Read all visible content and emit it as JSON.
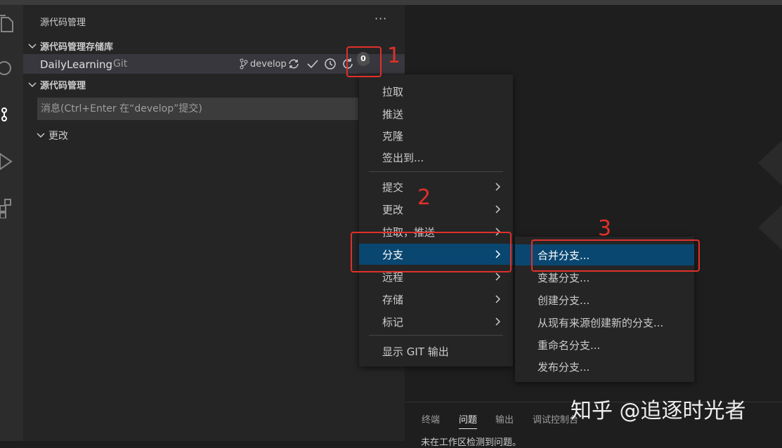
{
  "sidebar": {
    "title": "源代码管理",
    "more_icon": "ellipsis-icon",
    "repositories_header": "源代码管理存储库",
    "repo": {
      "name": "DailyLearning",
      "type": "Git",
      "branch": "develop",
      "badge_count": "0"
    },
    "scm_header": "源代码管理",
    "commit_placeholder": "消息(Ctrl+Enter 在“develop”提交)",
    "changes_label": "更改"
  },
  "context_menu": {
    "items": [
      {
        "label": "拉取"
      },
      {
        "label": "推送"
      },
      {
        "label": "克隆"
      },
      {
        "label": "签出到..."
      },
      {
        "label": "提交"
      },
      {
        "label": "更改"
      },
      {
        "label": "拉取，推送"
      },
      {
        "label": "分支"
      },
      {
        "label": "远程"
      },
      {
        "label": "存储"
      },
      {
        "label": "标记"
      },
      {
        "label": "显示 GIT 输出"
      }
    ]
  },
  "branch_submenu": {
    "items": [
      {
        "label": "合并分支..."
      },
      {
        "label": "变基分支..."
      },
      {
        "label": "创建分支..."
      },
      {
        "label": "从现有来源创建新的分支..."
      },
      {
        "label": "重命名分支..."
      },
      {
        "label": "发布分支..."
      }
    ]
  },
  "panel": {
    "tabs": [
      "终端",
      "问题",
      "输出",
      "调试控制台"
    ],
    "active_tab": "问题",
    "message": "未在工作区检测到问题。"
  },
  "annotations": {
    "n1": "1",
    "n2": "2",
    "n3": "3",
    "color": "#e0302a"
  },
  "watermark": "知乎 @追逐时光者",
  "colors": {
    "highlight": "#094771",
    "sidebar_bg": "#252526",
    "editor_bg": "#1e1e1e",
    "activity_bg": "#2c2c2c"
  }
}
